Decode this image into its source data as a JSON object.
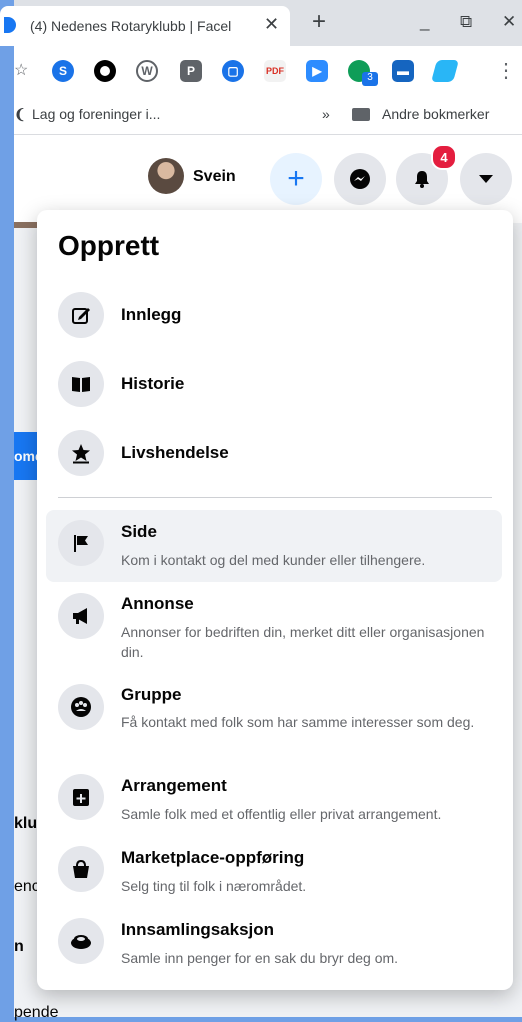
{
  "browser": {
    "tab_title": "(4) Nedenes Rotaryklubb | Facel",
    "bookmarks": [
      {
        "label": "Lag og foreninger i..."
      },
      {
        "label": "Andre bokmerker"
      }
    ],
    "more_bookmarks": "»",
    "extension_badge": "3"
  },
  "header": {
    "user_name": "Svein",
    "notification_count": "4"
  },
  "menu": {
    "title": "Opprett",
    "quick_items": [
      {
        "label": "Innlegg",
        "icon": "edit-icon"
      },
      {
        "label": "Historie",
        "icon": "book-icon"
      },
      {
        "label": "Livshendelse",
        "icon": "star-icon"
      }
    ],
    "items": [
      {
        "label": "Side",
        "description": "Kom i kontakt og del med kunder eller tilhengere.",
        "icon": "flag-icon"
      },
      {
        "label": "Annonse",
        "description": "Annonser for bedriften din, merket ditt eller organisasjonen din.",
        "icon": "megaphone-icon"
      },
      {
        "label": "Gruppe",
        "description": "Få kontakt med folk som har samme interesser som deg.",
        "icon": "group-icon"
      },
      {
        "label": "Arrangement",
        "description": "Samle folk med et offentlig eller privat arrangement.",
        "icon": "calendar-plus-icon"
      },
      {
        "label": "Marketplace-oppføring",
        "description": "Selg ting til folk i nærområdet.",
        "icon": "shopping-bag-icon"
      },
      {
        "label": "Innsamlingsaksjon",
        "description": "Samle inn penger for en sak du bryr deg om.",
        "icon": "fundraiser-icon"
      }
    ]
  },
  "background_fragments": {
    "a": "ome",
    "b": "klu",
    "c": "enc",
    "d": "n",
    "e": "pende"
  }
}
